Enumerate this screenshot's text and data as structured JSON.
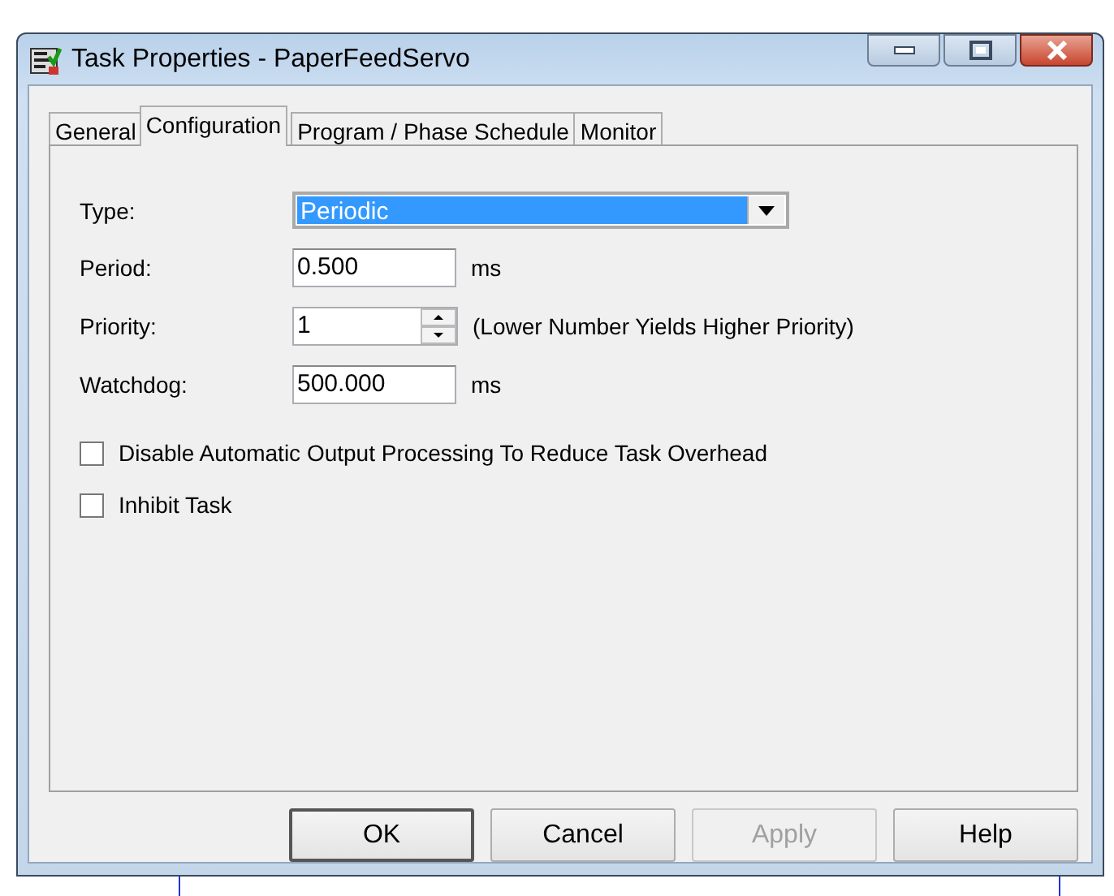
{
  "window": {
    "title": "Task Properties - PaperFeedServo"
  },
  "tabs": [
    {
      "label": "General",
      "selected": false
    },
    {
      "label": "Configuration",
      "selected": true
    },
    {
      "label": "Program / Phase Schedule",
      "selected": false
    },
    {
      "label": "Monitor",
      "selected": false
    }
  ],
  "fields": [
    {
      "kind": "dropdown",
      "label": "Type:",
      "value": "Periodic"
    },
    {
      "kind": "text",
      "label": "Period:",
      "value": "0.500",
      "unit": "ms"
    },
    {
      "kind": "spinner",
      "label": "Priority:",
      "value": "1",
      "note": "(Lower Number Yields Higher Priority)"
    },
    {
      "kind": "text",
      "label": "Watchdog:",
      "value": "500.000",
      "unit": "ms"
    }
  ],
  "checkboxes": [
    {
      "label": "Disable Automatic Output Processing To Reduce Task Overhead",
      "checked": false
    },
    {
      "label": "Inhibit Task",
      "checked": false
    }
  ],
  "buttons": [
    {
      "label": "OK",
      "disabled": false,
      "default": true
    },
    {
      "label": "Cancel",
      "disabled": false,
      "default": false
    },
    {
      "label": "Apply",
      "disabled": true,
      "default": false
    },
    {
      "label": "Help",
      "disabled": false,
      "default": false
    }
  ]
}
